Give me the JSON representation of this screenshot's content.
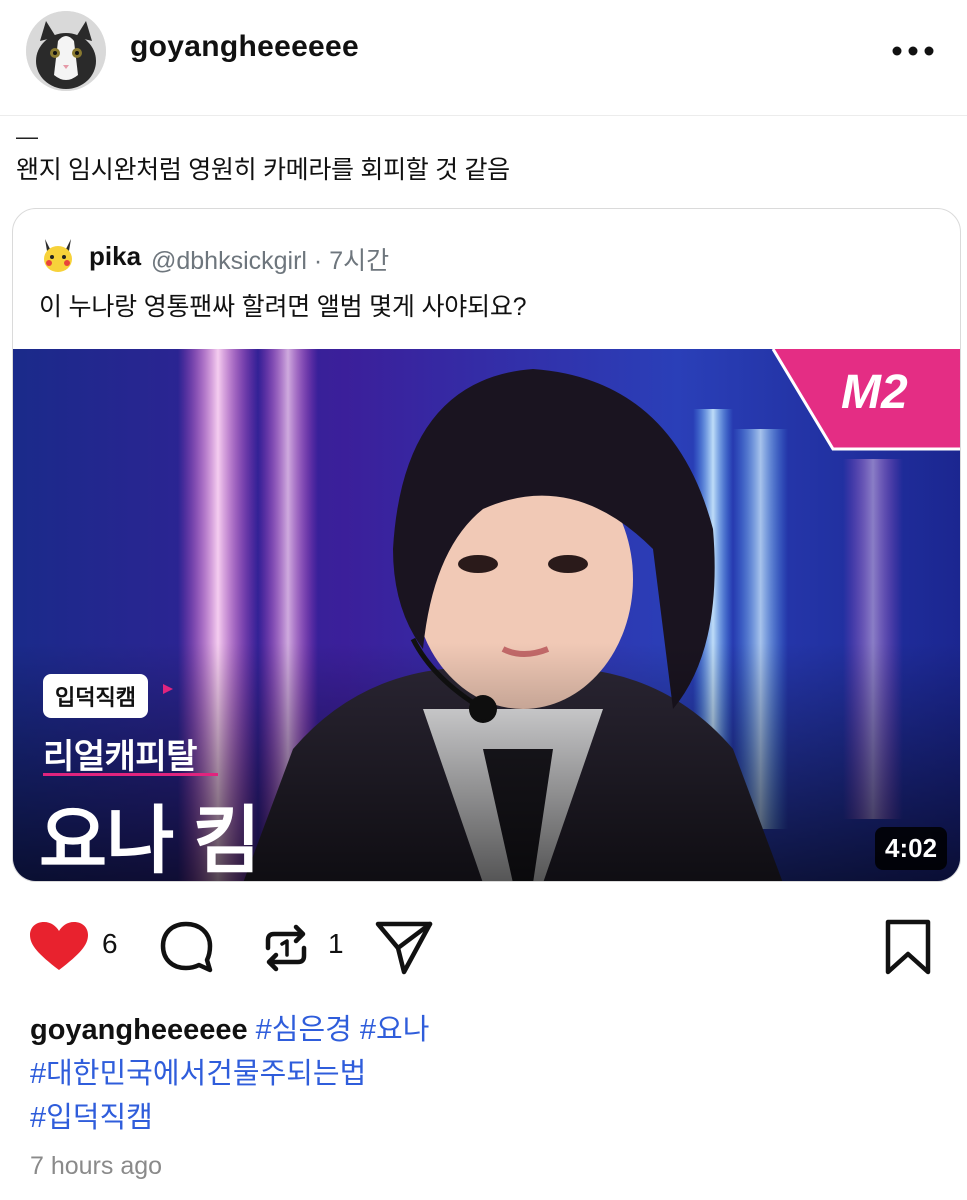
{
  "post": {
    "username": "goyangheeeeee",
    "more_icon": "more-horizontal-icon",
    "dash": "—",
    "caption": "왠지 임시완처럼 영원히 카메라를 회피할 것 같음"
  },
  "quoted": {
    "name": "pika",
    "handle_time": "@dbhksickgirl · 7시간",
    "text": "이 누나랑 영통팬싸 할려면 앨범 몇게 사야되요?",
    "video": {
      "brand_badge": "M2",
      "tag": "입덕직캠",
      "show_title": "리얼캐피탈",
      "person_name": "요나 킴",
      "duration": "4:02"
    }
  },
  "actions": {
    "like_count": "6",
    "repost_count": "1",
    "icons": [
      "heart-icon",
      "comment-icon",
      "repost-icon",
      "share-icon",
      "bookmark-icon"
    ],
    "like_color": "#e8222e"
  },
  "footer": {
    "username": "goyangheeeeee",
    "hashtags_line1": [
      "#심은경",
      "#요나"
    ],
    "hashtag_line2": "#대한민국에서건물주되는법",
    "hashtag_line3": "#입덕직캠",
    "timestamp": "7 hours ago",
    "hashtag_color": "#2f5ddb"
  }
}
